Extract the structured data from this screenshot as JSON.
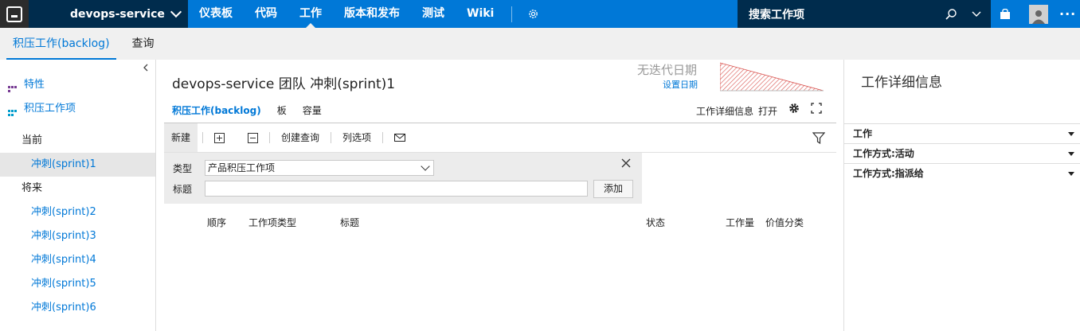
{
  "topbar": {
    "project": "devops-service",
    "nav": [
      "仪表板",
      "代码",
      "工作",
      "版本和发布",
      "测试",
      "Wiki"
    ],
    "active_nav": "工作",
    "search_label": "搜索工作项",
    "more": "···"
  },
  "subtabs": [
    "积压工作(backlog)",
    "查询"
  ],
  "left": {
    "features": "特性",
    "backlog_items": "积压工作项",
    "current_label": "当前",
    "current_sprint": "冲刺(sprint)1",
    "future_label": "将来",
    "future_sprints": [
      "冲刺(sprint)2",
      "冲刺(sprint)3",
      "冲刺(sprint)4",
      "冲刺(sprint)5",
      "冲刺(sprint)6"
    ]
  },
  "main": {
    "title": "devops-service 团队 冲刺(sprint)1",
    "no_iteration": "无迭代日期",
    "set_date": "设置日期",
    "tabs": [
      "积压工作(backlog)",
      "板",
      "容量"
    ],
    "detail_label": "工作详细信息",
    "detail_state": "打开",
    "toolbar": {
      "new": "新建",
      "create_query": "创建查询",
      "column_options": "列选项"
    },
    "add_panel": {
      "type_label": "类型",
      "type_value": "产品积压工作项",
      "title_label": "标题",
      "add_button": "添加"
    },
    "columns": [
      "顺序",
      "工作项类型",
      "标题",
      "状态",
      "工作量",
      "价值分类"
    ]
  },
  "right": {
    "title": "工作详细信息",
    "sections": [
      "工作",
      "工作方式:活动",
      "工作方式:指派给"
    ]
  },
  "colors": {
    "brand": "#0078d7",
    "dark": "#002c4d",
    "burndown": "#d9534f"
  }
}
